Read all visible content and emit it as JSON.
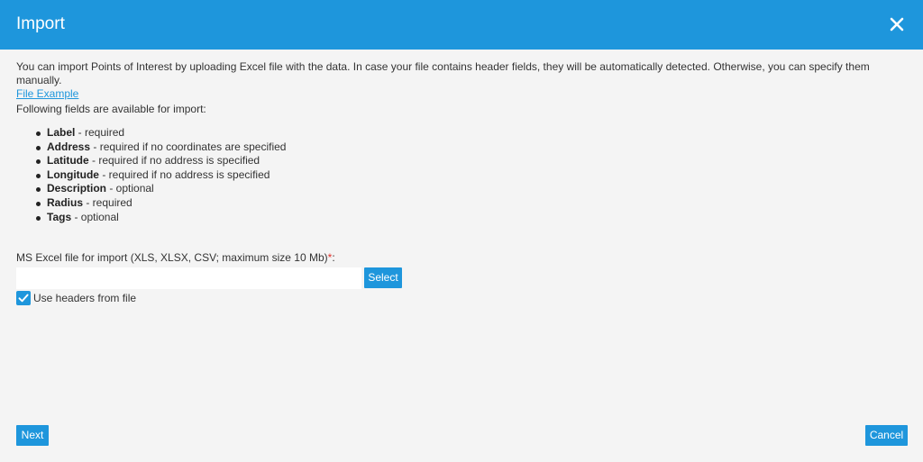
{
  "dialog": {
    "title": "Import",
    "close_icon": "close-icon"
  },
  "intro": {
    "text": "You can import Points of Interest by uploading Excel file with the data. In case your file contains header fields, they will be automatically detected. Otherwise, you can specify them manually.",
    "file_example_link": "File Example"
  },
  "fields": {
    "label": "Following fields are available for import:",
    "items": [
      {
        "name": "Label",
        "desc": " - required"
      },
      {
        "name": "Address",
        "desc": " - required if no coordinates are specified"
      },
      {
        "name": "Latitude",
        "desc": " - required if no address is specified"
      },
      {
        "name": "Longitude",
        "desc": " - required if no address is specified"
      },
      {
        "name": "Description",
        "desc": " - optional"
      },
      {
        "name": "Radius",
        "desc": " - required"
      },
      {
        "name": "Tags",
        "desc": " - optional"
      }
    ]
  },
  "file_upload": {
    "label": "MS Excel file for import (XLS, XLSX, CSV; maximum size 10 Mb)",
    "required_mark": "*",
    "colon": ":",
    "value": "",
    "select_label": "Select"
  },
  "options": {
    "use_headers_label": "Use headers from file",
    "use_headers_checked": true
  },
  "footer": {
    "next_label": "Next",
    "cancel_label": "Cancel"
  },
  "colors": {
    "accent": "#1e96dc",
    "background": "#f4f4f4",
    "required": "#e0312b"
  }
}
